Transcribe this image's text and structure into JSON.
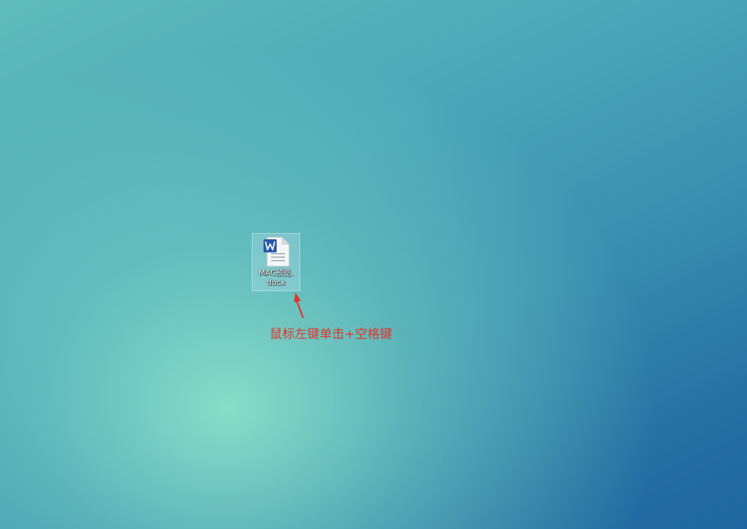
{
  "desktop": {
    "file_icon": {
      "icon": "word-document-icon",
      "name_line1": "MAC预览.",
      "name_line2": "docx"
    },
    "annotation": {
      "text": "鼠标左键单击+空格键",
      "color": "#e0342a",
      "arrow_icon": "red-arrow-icon"
    }
  }
}
